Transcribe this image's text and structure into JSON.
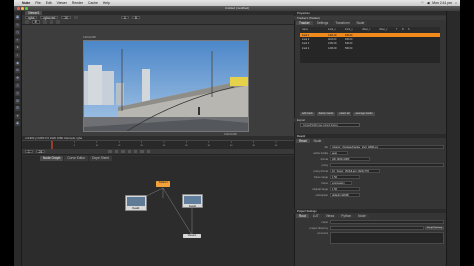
{
  "menubar": {
    "app_name": "Nuke",
    "items": [
      "File",
      "Edit",
      "Viewer",
      "Render",
      "Cache",
      "Help"
    ],
    "clock": "Mon 2:41 pm"
  },
  "window": {
    "title": "Untitled (modified)"
  },
  "viewer": {
    "tab": "Viewer1",
    "channels": "rgba",
    "layer": "rgba.red",
    "format": "1K",
    "zoom": "fit",
    "frame_label": "1920x1080",
    "info_line": "x=1900 y=1080   0.5 1920 1080 channels: rgba",
    "frame_caption_br": "1920x1080"
  },
  "timeline": {
    "ticks": [
      "1",
      "5",
      "10",
      "15",
      "20",
      "25",
      "30",
      "35",
      "40",
      "45",
      "50"
    ],
    "current_frame": "1"
  },
  "nodegraph": {
    "tabs": [
      "Node Graph",
      "Curve Editor",
      "Dope Sheet"
    ],
    "nodes": [
      "Tracker1",
      "Read1",
      "Read2",
      "Viewer1"
    ]
  },
  "properties": {
    "header": "Properties",
    "tracker_node": "Tracker1 (Tracker)",
    "tracker_tabs": [
      "Tracker",
      "Settings",
      "Transform",
      "Node"
    ],
    "track_columns": [
      "name",
      "track_x",
      "track_y",
      "offset_x",
      "offset_y",
      "T",
      "R",
      "S"
    ],
    "tracks": [
      {
        "name": "track 1",
        "x": "1304.00",
        "y": "640.00"
      },
      {
        "name": "track 2",
        "x": "1116.00",
        "y": "466.00"
      },
      {
        "name": "track 3",
        "x": "1330.00",
        "y": "640.00"
      },
      {
        "name": "track 4",
        "x": "1446.00",
        "y": "566.00"
      }
    ],
    "track_buttons": [
      "add track",
      "delete tracks",
      "select all",
      "average tracks"
    ],
    "export_label": "Export",
    "export_value": "CornerPin2D (use current frame)",
    "read_header": "Read1",
    "read_tabs": [
      "Read",
      "Node"
    ],
    "read_fields": [
      {
        "label": "file",
        "value": "/Users/.../footage/tracker_shot_####.exr"
      },
      {
        "label": "cache locally",
        "value": "auto"
      },
      {
        "label": "format",
        "value": "HD 1920x1080"
      },
      {
        "label": "proxy",
        "value": ""
      },
      {
        "label": "proxy format",
        "value": "1K_Super_35(full-ap) 1024x778"
      },
      {
        "label": "frame range",
        "value": "1       50"
      },
      {
        "label": "frame",
        "value": "expression"
      },
      {
        "label": "original range",
        "value": "1       50"
      },
      {
        "label": "colorspace",
        "value": "default (sRGB)"
      }
    ],
    "project_header": "Project Settings",
    "project_tabs": [
      "Root",
      "LUT",
      "Views",
      "Python",
      "Node"
    ],
    "project_fields": [
      {
        "label": "name",
        "value": ""
      },
      {
        "label": "project directory",
        "value": ""
      },
      {
        "label": "comment",
        "value": ""
      }
    ],
    "script_directory_button": "Script Directory"
  },
  "colors": {
    "track_highlight": "#f08a1c",
    "node_tracker": "#f3a13a",
    "node_read": "#e0e0e0",
    "node_viewer": "#d8d8d8",
    "playhead": "#e14b2b"
  }
}
